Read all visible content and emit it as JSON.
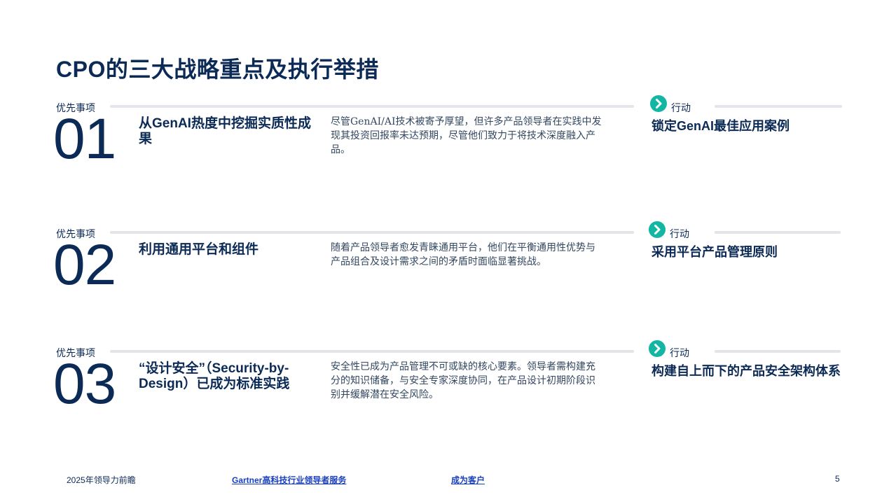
{
  "title": "CPO的三大战略重点及执行举措",
  "priorities": [
    {
      "label": "优先事项",
      "number": "01",
      "heading": "从GenAI热度中挖掘实质性成果",
      "description": "尽管GenAI/AI技术被寄予厚望，但许多产品领导者在实践中发现其投资回报率未达预期，尽管他们致力于将技术深度融入产品。",
      "action_label": "行动",
      "action": "锁定GenAI最佳应用案例"
    },
    {
      "label": "优先事项",
      "number": "02",
      "heading": "利用通用平台和组件",
      "description": "随着产品领导者愈发青睐通用平台，他们在平衡通用性优势与产品组合及设计需求之间的矛盾时面临显著挑战。",
      "action_label": "行动",
      "action": "采用平台产品管理原则"
    },
    {
      "label": "优先事项",
      "number": "03",
      "heading": "“设计安全”（Security-by-Design）已成为标准实践",
      "description": "安全性已成为产品管理不可或缺的核心要素。领导者需构建充分的知识储备，与安全专家深度协同，在产品设计初期阶段识别并缓解潜在安全风险。",
      "action_label": "行动",
      "action": "构建自上而下的产品安全架构体系"
    }
  ],
  "footer": {
    "left_text": "2025年领导力前瞻",
    "link1": "Gartner高科技行业领导者服务",
    "link2": "成为客户",
    "page_number": "5"
  },
  "colors": {
    "primary": "#0b2a55",
    "accent": "#12b6a3",
    "divider": "#e3e5e9",
    "link": "#1a3fbf"
  },
  "icons": {
    "action": "chevron-right-icon"
  }
}
